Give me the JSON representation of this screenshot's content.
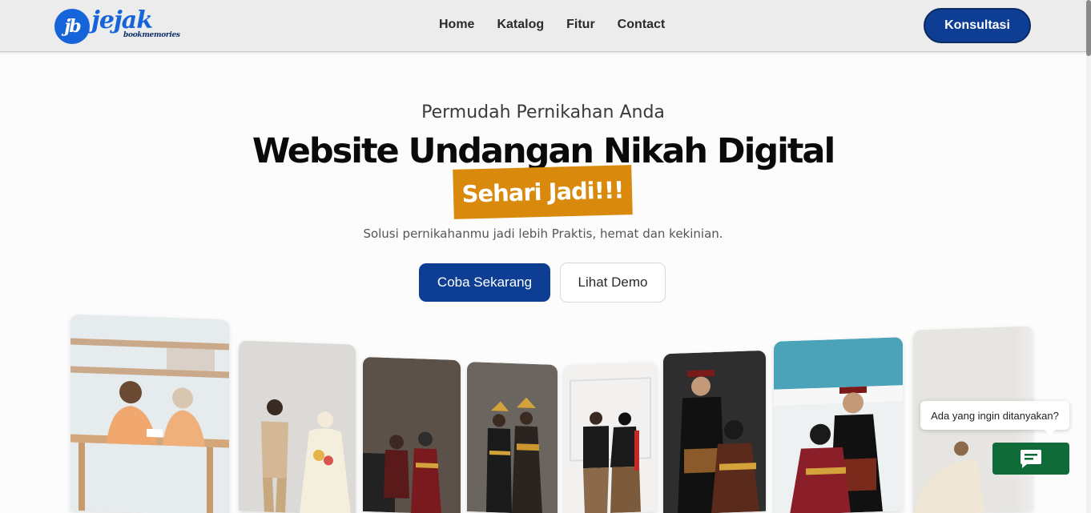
{
  "brand": {
    "logo_mark": "jb",
    "logo_word": "jejak",
    "logo_sub": "bookmemories",
    "primary_color": "#0d3e94",
    "accent_color": "#d98a0c",
    "logo_color": "#1664d9"
  },
  "nav": {
    "links": [
      "Home",
      "Katalog",
      "Fitur",
      "Contact"
    ],
    "cta_label": "Konsultasi"
  },
  "hero": {
    "eyebrow": "Permudah Pernikahan Anda",
    "title": "Website Undangan Nikah Digital",
    "highlight": "Sehari Jadi!!!",
    "subtitle": "Solusi pernikahanmu jadi lebih Praktis, hemat dan kekinian.",
    "primary_button": "Coba Sekarang",
    "secondary_button": "Lihat Demo"
  },
  "gallery": {
    "photo_icons": [
      "kitchen-couple-photo",
      "casual-couple-photo",
      "traditional-couple-dark-photo",
      "traditional-couple-gold-photo",
      "batik-couple-photo",
      "balinese-couple-photo",
      "balinese-couple-sky-photo",
      "casual-couple-light-photo"
    ]
  },
  "chat": {
    "prompt": "Ada yang ingin ditanyakan?",
    "button_icon": "chat-icon",
    "button_color": "#0f6b37"
  }
}
